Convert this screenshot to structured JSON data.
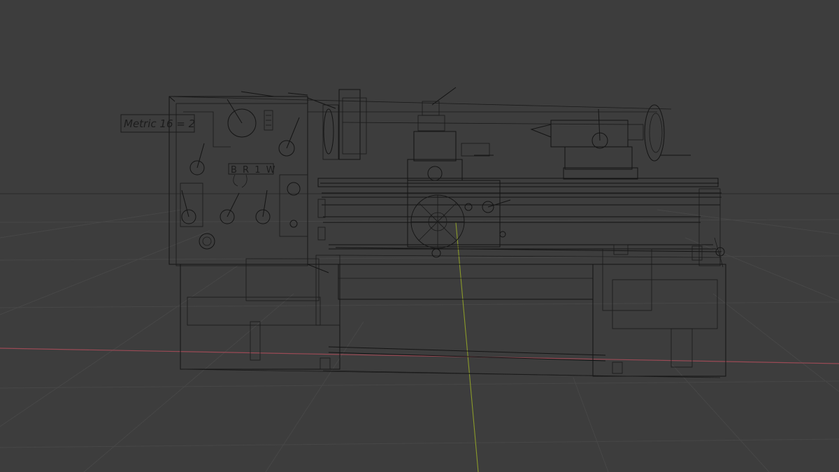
{
  "viewport": {
    "background_color": "#3d3d3d",
    "grid_color": "#4a4a4a",
    "x_axis_color": "#9a4a55",
    "y_axis_color": "#8a9a2a",
    "wireframe_color": "#141414"
  },
  "model_labels": {
    "thread_plate": "Metric 16 = 2",
    "gear_letters": "B R 1 W"
  }
}
